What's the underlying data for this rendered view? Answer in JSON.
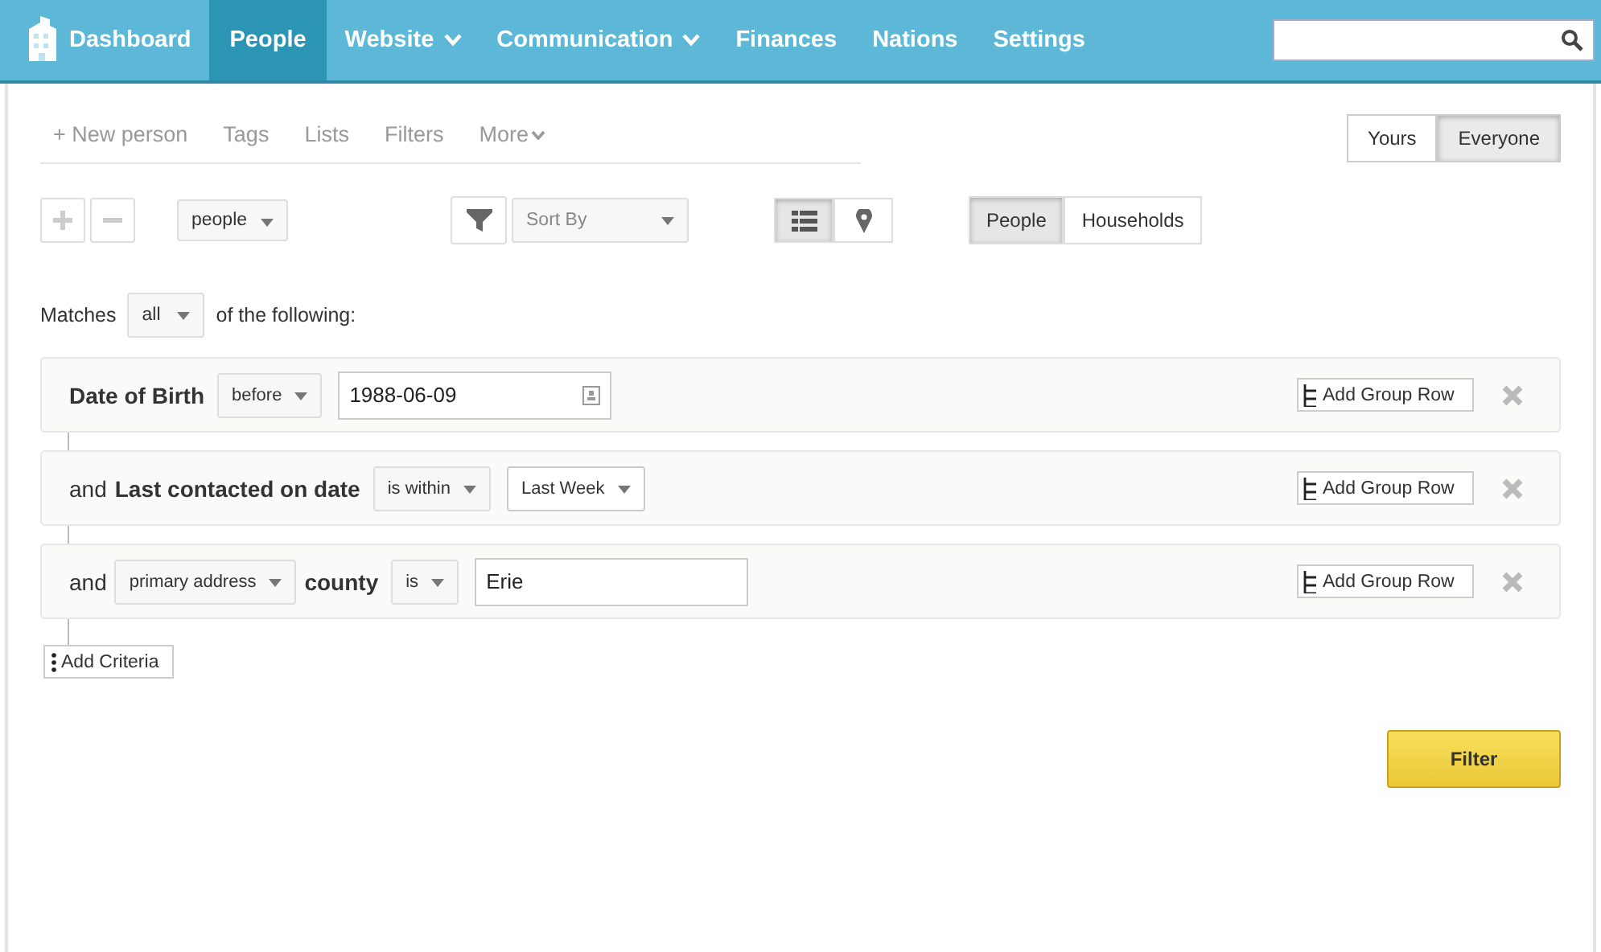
{
  "nav": {
    "items": [
      {
        "label": "Dashboard",
        "kind": "logo",
        "selected": false,
        "dropdown": false
      },
      {
        "label": "People",
        "kind": "link",
        "selected": true,
        "dropdown": false
      },
      {
        "label": "Website",
        "kind": "link",
        "selected": false,
        "dropdown": true
      },
      {
        "label": "Communication",
        "kind": "link",
        "selected": false,
        "dropdown": true
      },
      {
        "label": "Finances",
        "kind": "link",
        "selected": false,
        "dropdown": false
      },
      {
        "label": "Nations",
        "kind": "link",
        "selected": false,
        "dropdown": false
      },
      {
        "label": "Settings",
        "kind": "link",
        "selected": false,
        "dropdown": false
      }
    ]
  },
  "subnav": [
    {
      "label": "+ New person",
      "dropdown": false
    },
    {
      "label": "Tags",
      "dropdown": false
    },
    {
      "label": "Lists",
      "dropdown": false
    },
    {
      "label": "Filters",
      "dropdown": false
    },
    {
      "label": "More",
      "dropdown": true
    }
  ],
  "scope": [
    {
      "label": "Yours",
      "selected": false
    },
    {
      "label": "Everyone",
      "selected": true
    }
  ],
  "toolbar": {
    "type_select": "people",
    "sort_select": "Sort By",
    "views": [
      {
        "kind": "list",
        "selected": true
      },
      {
        "kind": "pin",
        "selected": false
      }
    ],
    "entities": [
      {
        "label": "People",
        "selected": true
      },
      {
        "label": "Households",
        "selected": false
      }
    ]
  },
  "matches": {
    "prefix": "Matches",
    "value": "all",
    "suffix": "of the following:"
  },
  "criteria": [
    {
      "parts": [
        {
          "kind": "label",
          "text": "Date of Birth"
        },
        {
          "kind": "select",
          "text": "before"
        },
        {
          "kind": "date",
          "text": "1988-06-09"
        }
      ],
      "group_button": "Add Group Row"
    },
    {
      "parts": [
        {
          "kind": "text",
          "text": "and"
        },
        {
          "kind": "label",
          "text": "Last contacted on date"
        },
        {
          "kind": "select",
          "text": "is within"
        },
        {
          "kind": "choice",
          "text": "Last Week"
        }
      ],
      "group_button": "Add Group Row"
    },
    {
      "parts": [
        {
          "kind": "text",
          "text": "and"
        },
        {
          "kind": "select",
          "text": "primary address"
        },
        {
          "kind": "label",
          "text": "county"
        },
        {
          "kind": "select",
          "text": "is"
        },
        {
          "kind": "input",
          "text": "Erie"
        }
      ],
      "group_button": "Add Group Row"
    }
  ],
  "add_criteria": "Add Criteria",
  "filter_button": "Filter"
}
